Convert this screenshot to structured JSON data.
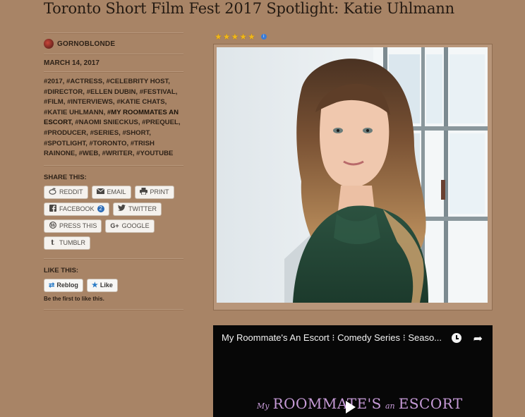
{
  "post": {
    "title": "Toronto Short Film Fest 2017 Spotlight: Katie Uhlmann",
    "author": "GORNOBLONDE",
    "date": "MARCH 14, 2017",
    "tags": [
      {
        "label": "#2017,"
      },
      {
        "label": "#ACTRESS,"
      },
      {
        "label": "#CELEBRITY HOST,"
      },
      {
        "label": "#DIRECTOR,"
      },
      {
        "label": "#ELLEN DUBIN,"
      },
      {
        "label": "#FESTIVAL,"
      },
      {
        "label": "#FILM,"
      },
      {
        "label": "#INTERVIEWS,"
      },
      {
        "label": "#KATIE CHATS,"
      },
      {
        "label": "#KATIE UHLMANN,"
      },
      {
        "label": "#MY ROOMMATES AN ESCORT,"
      },
      {
        "label": "#NAOMI SNIECKUS,"
      },
      {
        "label": "#PREQUEL,"
      },
      {
        "label": "#PRODUCER,"
      },
      {
        "label": "#SERIES,"
      },
      {
        "label": "#SHORT,"
      },
      {
        "label": "#SPOTLIGHT,"
      },
      {
        "label": "#TORONTO,"
      },
      {
        "label": "#TRISH RAINONE,"
      },
      {
        "label": "#WEB,"
      },
      {
        "label": "#WRITER,"
      },
      {
        "label": "#YOUTUBE"
      }
    ]
  },
  "share": {
    "heading": "SHARE THIS:",
    "buttons": {
      "reddit": "REDDIT",
      "email": "EMAIL",
      "print": "PRINT",
      "facebook": "FACEBOOK",
      "facebook_count": "2",
      "twitter": "TWITTER",
      "press_this": "PRESS THIS",
      "google": "GOOGLE",
      "tumblr": "TUMBLR"
    }
  },
  "like": {
    "heading": "LIKE THIS:",
    "reblog": "Reblog",
    "like": "Like",
    "note": "Be the first to like this."
  },
  "rating": {
    "stars": 5
  },
  "video": {
    "title": "My Roommate's An Escort ⁝ Comedy Series ⁝ Seaso...",
    "logo_my": "My",
    "logo_roommates": "ROOMMATE'S",
    "logo_an": "an",
    "logo_escort": "ESCORT"
  },
  "icons": {
    "reddit": "reddit-icon",
    "email": "envelope-icon",
    "print": "printer-icon",
    "facebook": "facebook-icon",
    "twitter": "twitter-icon",
    "press_this": "wordpress-icon",
    "google": "google-plus-icon",
    "tumblr": "tumblr-icon",
    "reblog": "reblog-icon",
    "like": "star-icon"
  },
  "colors": {
    "background": "#a88466",
    "badge": "#2a6ab6",
    "star": "#f0b81a",
    "video_logo": "#c79bd8"
  }
}
